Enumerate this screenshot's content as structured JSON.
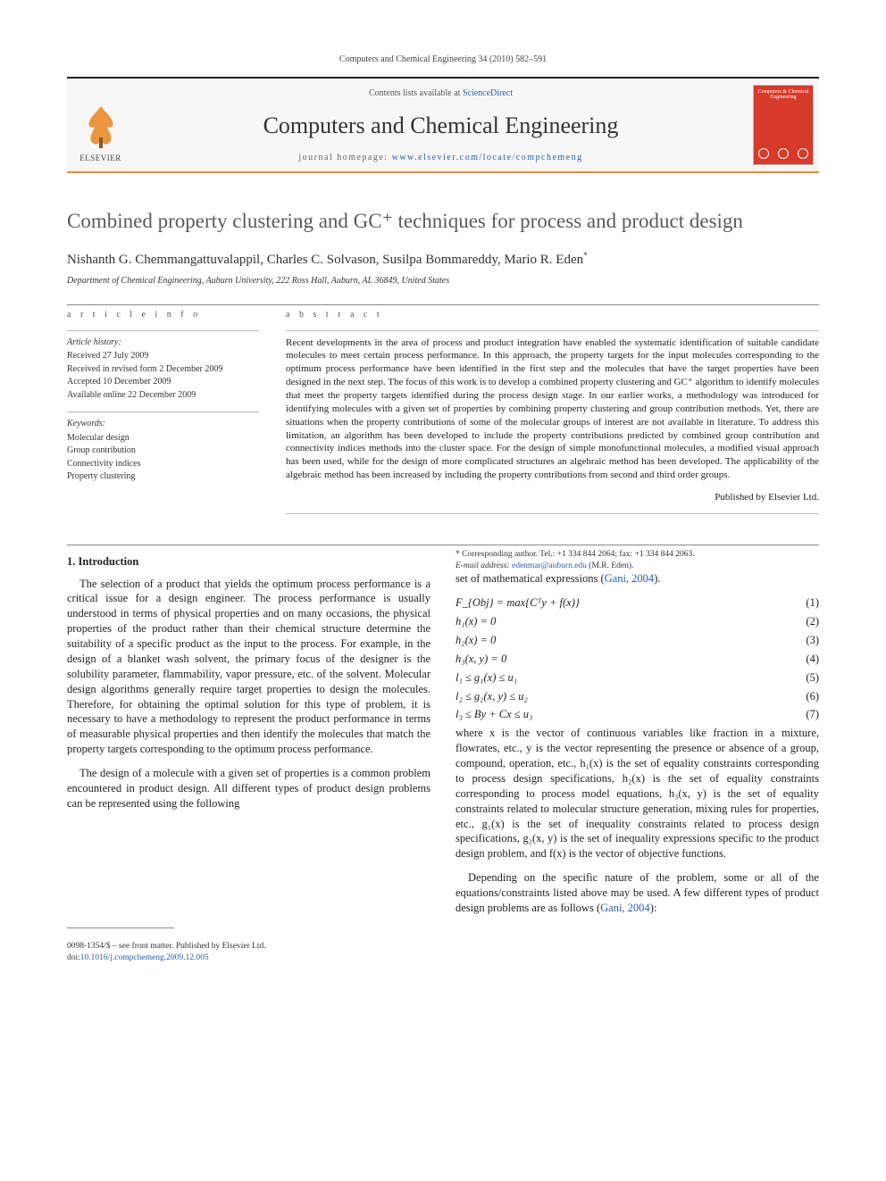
{
  "running_head": "Computers and Chemical Engineering 34 (2010) 582–591",
  "masthead": {
    "contents_prefix": "Contents lists available at ",
    "contents_link": "ScienceDirect",
    "journal": "Computers and Chemical Engineering",
    "homepage_prefix": "journal homepage: ",
    "homepage_link": "www.elsevier.com/locate/compchemeng",
    "publisher": "ELSEVIER",
    "cover_title": "Computers & Chemical Engineering"
  },
  "article": {
    "title": "Combined property clustering and GC⁺ techniques for process and product design",
    "authors": "Nishanth G. Chemmangattuvalappil, Charles C. Solvason, Susilpa Bommareddy, Mario R. Eden",
    "corr_mark": "*",
    "affiliation": "Department of Chemical Engineering, Auburn University, 222 Ross Hall, Auburn, AL 36849, United States"
  },
  "info": {
    "heading": "a r t i c l e   i n f o",
    "history_heading": "Article history:",
    "history": [
      "Received 27 July 2009",
      "Received in revised form 2 December 2009",
      "Accepted 10 December 2009",
      "Available online 22 December 2009"
    ],
    "keywords_heading": "Keywords:",
    "keywords": [
      "Molecular design",
      "Group contribution",
      "Connectivity indices",
      "Property clustering"
    ]
  },
  "abstract": {
    "heading": "a b s t r a c t",
    "text": "Recent developments in the area of process and product integration have enabled the systematic identification of suitable candidate molecules to meet certain process performance. In this approach, the property targets for the input molecules corresponding to the optimum process performance have been identified in the first step and the molecules that have the target properties have been designed in the next step. The focus of this work is to develop a combined property clustering and GC⁺ algorithm to identify molecules that meet the property targets identified during the process design stage. In our earlier works, a methodology was introduced for identifying molecules with a given set of properties by combining property clustering and group contribution methods. Yet, there are situations when the property contributions of some of the molecular groups of interest are not available in literature. To address this limitation, an algorithm has been developed to include the property contributions predicted by combined group contribution and connectivity indices methods into the cluster space. For the design of simple monofunctional molecules, a modified visual approach has been used, while for the design of more complicated structures an algebraic method has been developed. The applicability of the algebraic method has been increased by including the property contributions from second and third order groups.",
    "published": "Published by Elsevier Ltd."
  },
  "section1": {
    "heading": "1. Introduction",
    "p1": "The selection of a product that yields the optimum process performance is a critical issue for a design engineer. The process performance is usually understood in terms of physical properties and on many occasions, the physical properties of the product rather than their chemical structure determine the suitability of a specific product as the input to the process. For example, in the design of a blanket wash solvent, the primary focus of the designer is the solubility parameter, flammability, vapor pressure, etc. of the solvent. Molecular design algorithms generally require target properties to design the molecules. Therefore, for obtaining the optimal solution for this type of problem, it is necessary to have a methodology to represent the product performance in terms of measurable physical properties and then identify the molecules that match the property targets corresponding to the optimum process performance.",
    "p2": "The design of a molecule with a given set of properties is a common problem encountered in product design. All different types of product design problems can be represented using the following",
    "p3_lead": "set of mathematical expressions (",
    "p3_cite": "Gani, 2004",
    "p3_tail": ").",
    "p4": "where x is the vector of continuous variables like fraction in a mixture, flowrates, etc., y is the vector representing the presence or absence of a group, compound, operation, etc., h₁(x) is the set of equality constraints corresponding to process design specifications, h₂(x) is the set of equality constraints corresponding to process model equations, h₃(x, y) is the set of equality constraints related to molecular structure generation, mixing rules for properties, etc., g₁(x) is the set of inequality constraints related to process design specifications, g₂(x, y) is the set of inequality expressions specific to the product design problem, and f(x) is the vector of objective functions.",
    "p5_lead": "Depending on the specific nature of the problem, some or all of the equations/constraints listed above may be used. A few different types of product design problems are as follows (",
    "p5_cite": "Gani, 2004",
    "p5_tail": "):"
  },
  "equations": [
    {
      "math": "F_{Obj} = max{Cᵀy + f(x)}",
      "num": "(1)"
    },
    {
      "math": "h₁(x) = 0",
      "num": "(2)"
    },
    {
      "math": "h₂(x) = 0",
      "num": "(3)"
    },
    {
      "math": "h₃(x, y) = 0",
      "num": "(4)"
    },
    {
      "math": "l₁ ≤ g₁(x) ≤ u₁",
      "num": "(5)"
    },
    {
      "math": "l₂ ≤ g₂(x, y) ≤ u₂",
      "num": "(6)"
    },
    {
      "math": "l₃ ≤ By + Cx ≤ u₃",
      "num": "(7)"
    }
  ],
  "footnotes": {
    "corr": "* Corresponding author. Tel.: +1 334 844 2064; fax: +1 334 844 2063.",
    "email_label": "E-mail address: ",
    "email": "edenmar@auburn.edu",
    "email_tail": " (M.R. Eden)."
  },
  "copyright": {
    "line1": "0098-1354/$ – see front matter. Published by Elsevier Ltd.",
    "doi_label": "doi:",
    "doi": "10.1016/j.compchemeng.2009.12.005"
  }
}
